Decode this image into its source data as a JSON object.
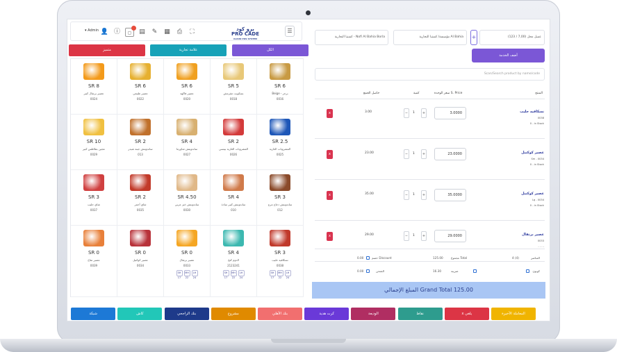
{
  "header": {
    "admin": "Admin",
    "logo_ar": "برو كود",
    "logo_en": "PRO CADE",
    "logo_sub": "CLOUD POS SYSTEM"
  },
  "categories": [
    {
      "label": "الكل",
      "color": "#7b57d6"
    },
    {
      "label": "علامة تجارية",
      "color": "#17a2b8"
    },
    {
      "label": "متميز",
      "color": "#dc3545"
    }
  ],
  "products": [
    {
      "price": "SR 6",
      "name": "Beige - برجر",
      "code": "0016",
      "img": "#c89a43"
    },
    {
      "price": "SR 5",
      "name": "بسكويت مقرمش",
      "code": "0018",
      "img": "#e8c878"
    },
    {
      "price": "SR 6",
      "name": "عصير فاكهة",
      "code": "0020",
      "img": "#f0a020"
    },
    {
      "price": "SR 6",
      "name": "عصير طبيعي",
      "code": "0022",
      "img": "#e6b030"
    },
    {
      "price": "SR 8",
      "name": "عصير برتقال كبير",
      "code": "0024",
      "img": "#f39a1a"
    },
    {
      "price": "SR 2.5",
      "name": "المشروبات الغازية",
      "code": "0025",
      "img": "#1e57b8"
    },
    {
      "price": "SR 2",
      "name": "المشروبات الغازية بيبسي",
      "code": "0026",
      "img": "#d33a3a"
    },
    {
      "price": "SR 4",
      "name": "ساندويتش شاورما",
      "code": "0027",
      "img": "#d8b070"
    },
    {
      "price": "SR 2",
      "name": "ساندويتش جبنة شيدر",
      "code": "013",
      "img": "#c0702b"
    },
    {
      "price": "SR 10",
      "name": "عجين بطاطس كبير",
      "code": "0029",
      "img": "#f0c040"
    },
    {
      "price": "SR 3",
      "name": "ساندويتش دجاج مرج",
      "code": "012",
      "img": "#8a4a2a"
    },
    {
      "price": "SR 4",
      "name": "ساندويتش كبير سادة",
      "code": "010",
      "img": "#d07a4a"
    },
    {
      "price": "SR 4.50",
      "name": "ساندويتش خبز عربي",
      "code": "0030",
      "img": "#e0b888"
    },
    {
      "price": "SR 2",
      "name": "شاي أحمر",
      "code": "0035",
      "img": "#c23a2a"
    },
    {
      "price": "SR 3",
      "name": "شاي حليب",
      "code": "0037",
      "img": "#d04040"
    },
    {
      "price": "SR 3",
      "name": "نسكافيه حليب",
      "code": "0038",
      "img": "#c0392b"
    },
    {
      "price": "SR 4",
      "name": "الدوم كنج",
      "code": "2123241",
      "img": "#3cb8b0"
    },
    {
      "price": "SR 0",
      "name": "عصير برتقال",
      "code": "0033",
      "img": "#f5a623"
    },
    {
      "price": "SR 0",
      "name": "عصير كوكتيل",
      "code": "0034",
      "img": "#b8323a"
    },
    {
      "price": "SR 0",
      "name": "عصير تفاح",
      "code": "0039",
      "img": "#e8803a"
    }
  ],
  "sizes": [
    "SH",
    "MH",
    "LH",
    "SH",
    "MH",
    "LH",
    "SH",
    "MH",
    "LH"
  ],
  "sizes_bottom": [
    "17",
    "22",
    "24",
    "17",
    "22",
    "24",
    "17",
    "22",
    "24"
  ],
  "right": {
    "customer": "عميل محل (7,00 / 123)",
    "store": "Al Bahia مؤسسة/ كشتبا التجارية",
    "warehouse": "Nofi Al Bahia Borla - كشتبا التجارية",
    "add_service": "أضف الخدمة",
    "search_placeholder": "Scan/Search product by name/code",
    "col_product": "المنتج",
    "col_price": "سعر الوحدة S. Price",
    "col_qty": "كمية",
    "col_total": "حاصل الجمع"
  },
  "cart": [
    {
      "name": "نسكافيه حليب",
      "code": "0038",
      "stock": "0 - in Stock",
      "qty": "1",
      "price": "3.0000",
      "total": "3.00"
    },
    {
      "name": "عصير كوكتيل",
      "code": "Sm - 0034",
      "stock": "0 - in Stock",
      "qty": "1",
      "price": "23.0000",
      "total": "23.00"
    },
    {
      "name": "عصير كوكتيل",
      "code": "Lg - 0034",
      "stock": "0 - in Stock",
      "qty": "1",
      "price": "35.0000",
      "total": "35.00"
    },
    {
      "name": "عصير برتقال",
      "code": "0033",
      "stock": "- - - -",
      "qty": "1",
      "price": "29.0000",
      "total": "29.00"
    }
  ],
  "totals": {
    "items_label": "العناصر",
    "items_val": "4 (4)",
    "total_label": "مجموع Total",
    "total_val": "125.00",
    "discount_label": "خصم Discount",
    "discount_val": "0.00",
    "coupon_label": "كوبون",
    "tax_label": "ضريبة",
    "tax_val": "16.30",
    "shipping_label": "الشحن",
    "shipping_val": "0.00"
  },
  "grand_total": "المبلغ الإجمالي Grand Total 125.00",
  "actions": [
    {
      "label": "المعاملة الأخيرة",
      "color": "#f0b400"
    },
    {
      "label": "x يلغي",
      "color": "#dc3545"
    },
    {
      "label": "نقاط",
      "color": "#2e9c8e"
    },
    {
      "label": "الوديعة",
      "color": "#b02e62"
    },
    {
      "label": "كرت هدية",
      "color": "#6a39d8"
    },
    {
      "label": "بنك الأهلي",
      "color": "#f16f6f"
    },
    {
      "label": "مشروع",
      "color": "#e08a00"
    },
    {
      "label": "بنك الراجحي",
      "color": "#1e3a8a"
    },
    {
      "label": "كاش",
      "color": "#22c7b8"
    },
    {
      "label": "شبكة",
      "color": "#1d79d6"
    }
  ]
}
